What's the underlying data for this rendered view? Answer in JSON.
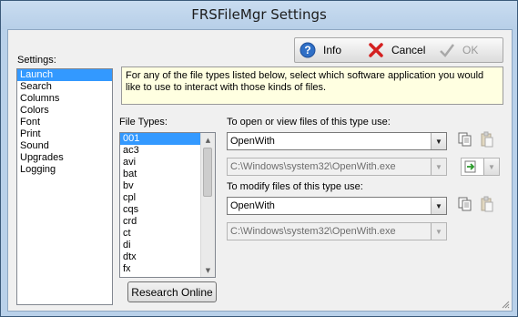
{
  "window": {
    "title": "FRSFileMgr Settings"
  },
  "toolbar": {
    "info_label": "Info",
    "cancel_label": "Cancel",
    "ok_label": "OK"
  },
  "settings": {
    "label": "Settings:",
    "items": [
      "Launch",
      "Search",
      "Columns",
      "Colors",
      "Font",
      "Print",
      "Sound",
      "Upgrades",
      "Logging"
    ],
    "selected": "Launch"
  },
  "info_text": "For any of the file types listed below, select which software application you would like to use to interact with those kinds of files.",
  "file_types": {
    "label": "File Types:",
    "items": [
      "001",
      "ac3",
      "avi",
      "bat",
      "bv",
      "cpl",
      "cqs",
      "crd",
      "ct",
      "di",
      "dtx",
      "fx"
    ],
    "selected": "001"
  },
  "open_section": {
    "label": "To open or view files of this type use:",
    "selected_value": "OpenWith",
    "path_value": "C:\\Windows\\system32\\OpenWith.exe"
  },
  "modify_section": {
    "label": "To modify files of this type use:",
    "selected_value": "OpenWith",
    "path_value": "C:\\Windows\\system32\\OpenWith.exe"
  },
  "research_button": "Research Online",
  "colors": {
    "selection": "#3399ff",
    "info_bg": "#ffffe1",
    "frame": "#b9d1ea"
  }
}
